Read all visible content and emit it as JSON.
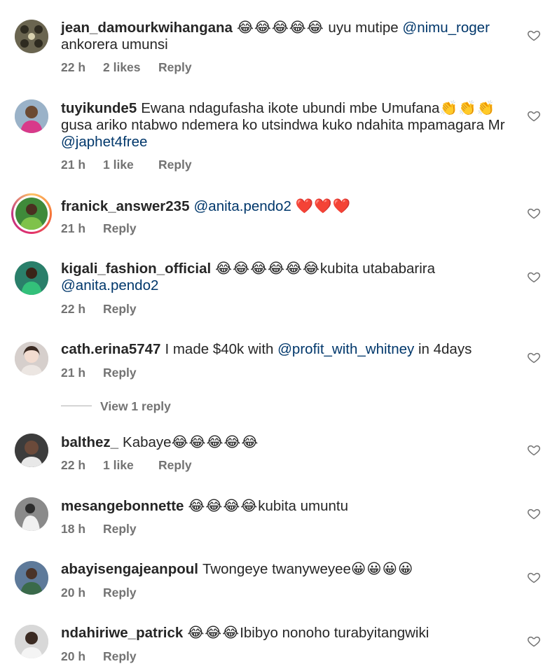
{
  "comments": [
    {
      "username": "jean_damourkwihangana",
      "emoji": "😂😂😂😂😂",
      "text_before": " uyu mutipe ",
      "mention": "@nimu_roger",
      "text_after": " ankorera umunsi",
      "time": "22 h",
      "likes": "2 likes",
      "reply": "Reply",
      "avatar_color": "#6a6550"
    },
    {
      "username": "tuyikunde5",
      "text_before": "Ewana ndagufasha ikote ubundi mbe Umufana",
      "emoji": "👏👏👏",
      "text_mid": " gusa ariko ntabwo ndemera ko utsindwa kuko ndahita mpamagara Mr ",
      "mention": "@japhet4free",
      "time": "21 h",
      "likes": "1 like",
      "reply": "Reply",
      "avatar_color": "#9ab2c8"
    },
    {
      "username": "franick_answer235",
      "mention": "@anita.pendo2",
      "emoji": "❤️❤️❤️",
      "time": "21 h",
      "reply": "Reply",
      "avatar_color": "#3f8a3a"
    },
    {
      "username": "kigali_fashion_official",
      "emoji": "😂😂😂😂😂😂",
      "text_before": "kubita utababarira ",
      "mention": "@anita.pendo2",
      "time": "22 h",
      "reply": "Reply",
      "avatar_color": "#2a7f6a"
    },
    {
      "username": "cath.erina5747",
      "text_before": "I made $40k with ",
      "mention": "@profit_with_whitney",
      "text_after": " in 4days",
      "time": "21 h",
      "reply": "Reply",
      "view_replies": "View 1 reply",
      "avatar_color": "#d6cfcc"
    },
    {
      "username": "balthez_",
      "text_before": "Kabaye",
      "emoji": "😂😂😂😂😂",
      "time": "22 h",
      "likes": "1 like",
      "reply": "Reply",
      "avatar_color": "#3c3c3c"
    },
    {
      "username": "mesangebonnette",
      "emoji": "😂😂😂😂",
      "text_before": "kubita umuntu",
      "time": "18 h",
      "reply": "Reply",
      "avatar_color": "#8a8a8a"
    },
    {
      "username": "abayisengajeanpoul",
      "text_before": "Twongeye twanyweyee",
      "emoji": "😀😀😀😀",
      "time": "20 h",
      "reply": "Reply",
      "avatar_color": "#5e7a9a"
    },
    {
      "username": "ndahiriwe_patrick",
      "emoji": "😂😂😂",
      "text_before": "Ibibyo nonoho turabyitangwiki",
      "time": "20 h",
      "reply": "Reply",
      "avatar_color": "#d8d8d8"
    }
  ]
}
